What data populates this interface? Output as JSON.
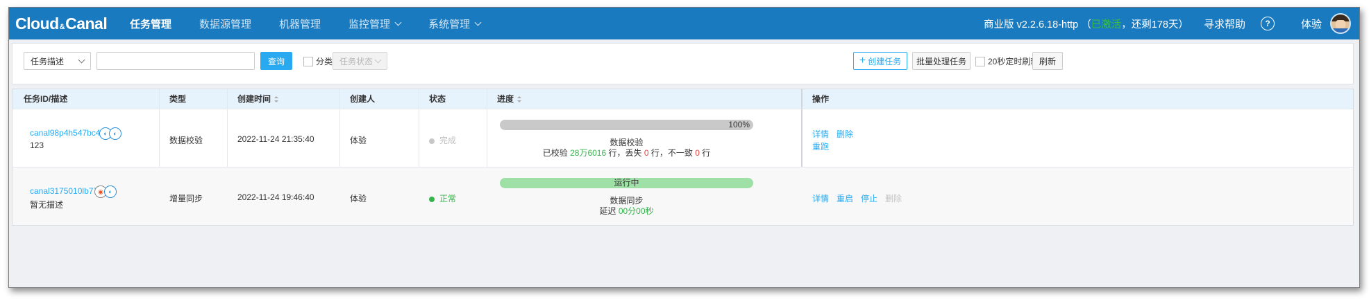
{
  "header": {
    "logo": {
      "part1": "Cloud",
      "amp": "&",
      "part2": "Canal"
    },
    "nav": [
      {
        "label": "任务管理",
        "active": true
      },
      {
        "label": "数据源管理"
      },
      {
        "label": "机器管理"
      },
      {
        "label": "监控管理"
      },
      {
        "label": "系统管理"
      }
    ],
    "version_prefix": "商业版 v2.2.6.18-http",
    "version_paren_open": "（",
    "activated": "已激活",
    "version_suffix": "，还剩178天）",
    "help": "寻求帮助",
    "help_icon": "?",
    "user": "体验"
  },
  "filter": {
    "field_select": "任务描述",
    "search_value": "",
    "query_button": "查询",
    "category_label": "分类",
    "status_select": "任务状态",
    "create_button": "创建任务",
    "create_icon": "+",
    "batch_button": "批量处理任务",
    "auto_refresh_label": "20秒定时刷新",
    "refresh_button": "刷新"
  },
  "table": {
    "columns": [
      "任务ID/描述",
      "类型",
      "创建时间",
      "创建人",
      "状态",
      "进度",
      "操作"
    ],
    "rows": [
      {
        "id": "canal98p4h547bc4",
        "desc": "123",
        "type": "数据校验",
        "created": "2022-11-24 21:35:40",
        "creator": "体验",
        "status": "完成",
        "status_color": "#c7c7c7",
        "progress_label": "100%",
        "progress_title": "数据校验",
        "detail": {
          "prefix": "已校验 ",
          "v1": "28万6016",
          "mid1": " 行，丢失 ",
          "v2": "0",
          "mid2": " 行，不一致 ",
          "v3": "0",
          "suffix": " 行"
        },
        "actions": [
          "详情",
          "删除",
          "重跑"
        ]
      },
      {
        "id": "canal3175010lb77",
        "desc": "暂无描述",
        "type": "增量同步",
        "created": "2022-11-24 19:46:40",
        "creator": "体验",
        "status": "正常",
        "status_color": "#35b54a",
        "progress_label": "运行中",
        "progress_title": "数据同步",
        "detail": {
          "prefix": "延迟 ",
          "v1": "00分00秒"
        },
        "actions": [
          "详情",
          "重启",
          "停止",
          "删除"
        ]
      }
    ]
  }
}
